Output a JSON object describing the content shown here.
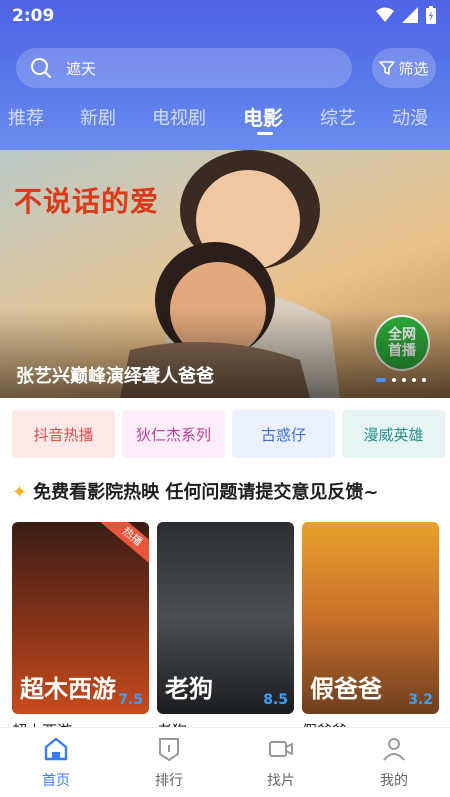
{
  "status_bar": {
    "time": "2:09"
  },
  "search": {
    "placeholder": "遮天",
    "filter_label": "筛选"
  },
  "tabs": [
    "推荐",
    "新剧",
    "电视剧",
    "电影",
    "综艺",
    "动漫"
  ],
  "active_tab": "电影",
  "banner": {
    "title": "张艺兴巅峰演绎聋人爸爸",
    "logo_text": "不说话的爱",
    "badge_line1": "全网",
    "badge_line2": "首播",
    "slides": 5,
    "active_slide": 1
  },
  "chips": [
    {
      "label": "抖音热播",
      "bg": "#fde8e8",
      "fg": "#e0504a"
    },
    {
      "label": "狄仁杰系列",
      "bg": "#fbeefa",
      "fg": "#c0409c"
    },
    {
      "label": "古惑仔",
      "bg": "#eaf1fc",
      "fg": "#3f6fcf"
    },
    {
      "label": "漫威英雄",
      "bg": "#e6f5f4",
      "fg": "#2a8f8a"
    }
  ],
  "section": {
    "title": "免费看影院热映 任何问题请提交意见反馈~"
  },
  "movies": [
    {
      "name": "超木西游",
      "poster_text": "超木西游",
      "rating": "7.5",
      "tag": "热播"
    },
    {
      "name": "老狗",
      "poster_text": "老狗",
      "rating": "8.5",
      "tag": ""
    },
    {
      "name": "假爸爸",
      "poster_text": "假爸爸",
      "rating": "3.2",
      "tag": ""
    }
  ],
  "nav": [
    {
      "label": "首页",
      "icon": "home-icon"
    },
    {
      "label": "排行",
      "icon": "ranking-icon"
    },
    {
      "label": "找片",
      "icon": "video-camera-icon"
    },
    {
      "label": "我的",
      "icon": "user-icon"
    }
  ],
  "colors": {
    "accent": "#3b7cf6",
    "header_start": "#4f63e6",
    "header_end": "#6a8bee",
    "rating": "#3aa0ff"
  }
}
